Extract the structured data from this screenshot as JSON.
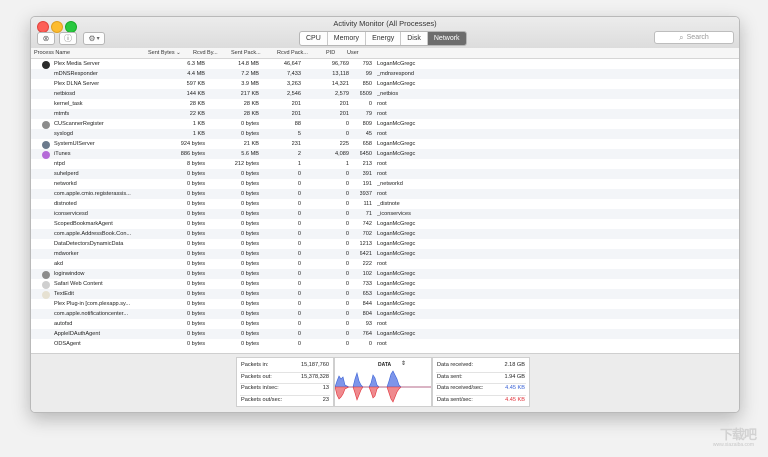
{
  "window": {
    "title": "Activity Monitor (All Processes)"
  },
  "toolbar": {
    "tabs": [
      {
        "label": "CPU",
        "active": false
      },
      {
        "label": "Memory",
        "active": false
      },
      {
        "label": "Energy",
        "active": false
      },
      {
        "label": "Disk",
        "active": false
      },
      {
        "label": "Network",
        "active": true
      }
    ],
    "search_placeholder": "Search"
  },
  "table": {
    "columns": [
      "Process Name",
      "Sent Bytes",
      "Rcvd By...",
      "Sent Pack...",
      "Rcvd Pack...",
      "PID",
      "User"
    ],
    "rows": [
      {
        "name": "Plex Media Server",
        "sent": "6.3 MB",
        "rcvd": "14.8 MB",
        "spk": "46,647",
        "rpk": "96,769",
        "pid": "793",
        "user": "LoganMcGregc",
        "icon": "plex-icon"
      },
      {
        "name": "mDNSResponder",
        "sent": "4.4 MB",
        "rcvd": "7.2 MB",
        "spk": "7,433",
        "rpk": "13,118",
        "pid": "99",
        "user": "_mdnsrespond",
        "icon": ""
      },
      {
        "name": "Plex DLNA Server",
        "sent": "597 KB",
        "rcvd": "3.9 MB",
        "spk": "3,263",
        "rpk": "14,321",
        "pid": "850",
        "user": "LoganMcGregc",
        "icon": ""
      },
      {
        "name": "netbiosd",
        "sent": "144 KB",
        "rcvd": "217 KB",
        "spk": "2,546",
        "rpk": "2,579",
        "pid": "6509",
        "user": "_netbios",
        "icon": ""
      },
      {
        "name": "kernel_task",
        "sent": "28 KB",
        "rcvd": "28 KB",
        "spk": "201",
        "rpk": "201",
        "pid": "0",
        "user": "root",
        "icon": ""
      },
      {
        "name": "mtmfs",
        "sent": "22 KB",
        "rcvd": "28 KB",
        "spk": "201",
        "rpk": "201",
        "pid": "79",
        "user": "root",
        "icon": ""
      },
      {
        "name": "CUScannerRegister",
        "sent": "1 KB",
        "rcvd": "0 bytes",
        "spk": "88",
        "rpk": "0",
        "pid": "809",
        "user": "LoganMcGregc",
        "icon": "scanner-icon"
      },
      {
        "name": "syslogd",
        "sent": "1 KB",
        "rcvd": "0 bytes",
        "spk": "5",
        "rpk": "0",
        "pid": "45",
        "user": "root",
        "icon": ""
      },
      {
        "name": "SystemUIServer",
        "sent": "924 bytes",
        "rcvd": "21 KB",
        "spk": "231",
        "rpk": "225",
        "pid": "658",
        "user": "LoganMcGregc",
        "icon": "system-ui-icon"
      },
      {
        "name": "iTunes",
        "sent": "886 bytes",
        "rcvd": "5.6 MB",
        "spk": "2",
        "rpk": "4,089",
        "pid": "6450",
        "user": "LoganMcGregc",
        "icon": "itunes-icon"
      },
      {
        "name": "ntpd",
        "sent": "8 bytes",
        "rcvd": "212 bytes",
        "spk": "1",
        "rpk": "1",
        "pid": "213",
        "user": "root",
        "icon": ""
      },
      {
        "name": "suhelperd",
        "sent": "0 bytes",
        "rcvd": "0 bytes",
        "spk": "0",
        "rpk": "0",
        "pid": "391",
        "user": "root",
        "icon": ""
      },
      {
        "name": "networkd",
        "sent": "0 bytes",
        "rcvd": "0 bytes",
        "spk": "0",
        "rpk": "0",
        "pid": "191",
        "user": "_networkd",
        "icon": ""
      },
      {
        "name": "com.apple.cmio.registerassis...",
        "sent": "0 bytes",
        "rcvd": "0 bytes",
        "spk": "0",
        "rpk": "0",
        "pid": "3937",
        "user": "root",
        "icon": ""
      },
      {
        "name": "distnoted",
        "sent": "0 bytes",
        "rcvd": "0 bytes",
        "spk": "0",
        "rpk": "0",
        "pid": "111",
        "user": "_distnote",
        "icon": ""
      },
      {
        "name": "iconservicesd",
        "sent": "0 bytes",
        "rcvd": "0 bytes",
        "spk": "0",
        "rpk": "0",
        "pid": "71",
        "user": "_iconservices",
        "icon": ""
      },
      {
        "name": "ScopedBookmarkAgent",
        "sent": "0 bytes",
        "rcvd": "0 bytes",
        "spk": "0",
        "rpk": "0",
        "pid": "742",
        "user": "LoganMcGregc",
        "icon": ""
      },
      {
        "name": "com.apple.AddressBook.Con...",
        "sent": "0 bytes",
        "rcvd": "0 bytes",
        "spk": "0",
        "rpk": "0",
        "pid": "702",
        "user": "LoganMcGregc",
        "icon": ""
      },
      {
        "name": "DataDetectorsDynamicData",
        "sent": "0 bytes",
        "rcvd": "0 bytes",
        "spk": "0",
        "rpk": "0",
        "pid": "1213",
        "user": "LoganMcGregc",
        "icon": ""
      },
      {
        "name": "mdworker",
        "sent": "0 bytes",
        "rcvd": "0 bytes",
        "spk": "0",
        "rpk": "0",
        "pid": "6421",
        "user": "LoganMcGregc",
        "icon": ""
      },
      {
        "name": "akd",
        "sent": "0 bytes",
        "rcvd": "0 bytes",
        "spk": "0",
        "rpk": "0",
        "pid": "222",
        "user": "root",
        "icon": ""
      },
      {
        "name": "loginwindow",
        "sent": "0 bytes",
        "rcvd": "0 bytes",
        "spk": "0",
        "rpk": "0",
        "pid": "102",
        "user": "LoganMcGregc",
        "icon": "loginwindow-icon"
      },
      {
        "name": "Safari Web Content",
        "sent": "0 bytes",
        "rcvd": "0 bytes",
        "spk": "0",
        "rpk": "0",
        "pid": "733",
        "user": "LoganMcGregc",
        "icon": "safari-doc-icon"
      },
      {
        "name": "TextEdit",
        "sent": "0 bytes",
        "rcvd": "0 bytes",
        "spk": "0",
        "rpk": "0",
        "pid": "653",
        "user": "LoganMcGregc",
        "icon": "textedit-icon"
      },
      {
        "name": "Plex Plug-in [com.plexapp.sy...",
        "sent": "0 bytes",
        "rcvd": "0 bytes",
        "spk": "0",
        "rpk": "0",
        "pid": "844",
        "user": "LoganMcGregc",
        "icon": ""
      },
      {
        "name": "com.apple.notificationcenter...",
        "sent": "0 bytes",
        "rcvd": "0 bytes",
        "spk": "0",
        "rpk": "0",
        "pid": "804",
        "user": "LoganMcGregc",
        "icon": ""
      },
      {
        "name": "autofsd",
        "sent": "0 bytes",
        "rcvd": "0 bytes",
        "spk": "0",
        "rpk": "0",
        "pid": "93",
        "user": "root",
        "icon": ""
      },
      {
        "name": "AppleIDAuthAgent",
        "sent": "0 bytes",
        "rcvd": "0 bytes",
        "spk": "0",
        "rpk": "0",
        "pid": "764",
        "user": "LoganMcGregc",
        "icon": ""
      },
      {
        "name": "ODSAgent",
        "sent": "0 bytes",
        "rcvd": "0 bytes",
        "spk": "0",
        "rpk": "0",
        "pid": "0",
        "user": "root",
        "icon": ""
      }
    ]
  },
  "footer": {
    "packets": [
      {
        "label": "Packets in:",
        "value": "15,187,760"
      },
      {
        "label": "Packets out:",
        "value": "15,378,328"
      },
      {
        "label": "Packets in/sec:",
        "value": "13"
      },
      {
        "label": "Packets out/sec:",
        "value": "23"
      }
    ],
    "graph_label": "DATA",
    "data": [
      {
        "label": "Data received:",
        "value": "2.18 GB",
        "color": "#222222"
      },
      {
        "label": "Data sent:",
        "value": "1.94 GB",
        "color": "#222222"
      },
      {
        "label": "Data received/sec:",
        "value": "4.45 KB",
        "color": "#3b63d6"
      },
      {
        "label": "Data sent/sec:",
        "value": "4.45 KB",
        "color": "#e0333b"
      }
    ]
  },
  "watermark": {
    "text": "下载吧",
    "sub": "www.xiazaiba.com"
  },
  "colors": {
    "received": "#4c6fe0",
    "sent": "#e0333b",
    "active_tab": "#6d6d6d"
  }
}
